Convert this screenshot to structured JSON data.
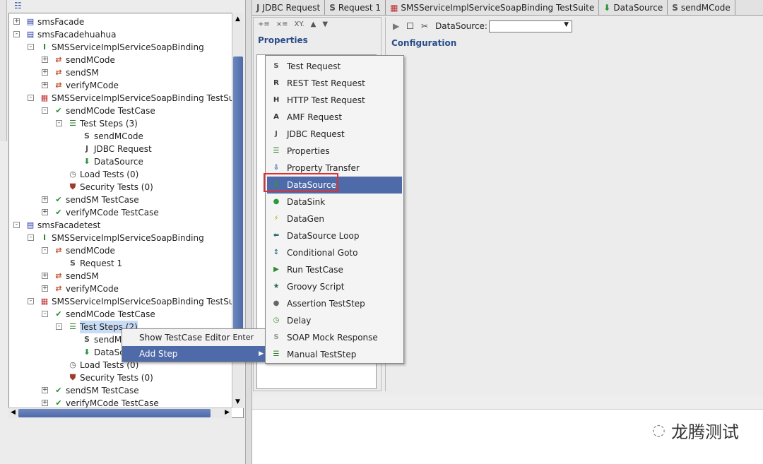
{
  "tree": [
    {
      "label": "smsFacade",
      "level": 0,
      "exp": "+",
      "icon": "project-icon"
    },
    {
      "label": "smsFacadehuahua",
      "level": 0,
      "exp": "-",
      "icon": "project-icon"
    },
    {
      "label": "SMSServiceImplServiceSoapBinding",
      "level": 1,
      "exp": "-",
      "icon": "interface-icon"
    },
    {
      "label": "sendMCode",
      "level": 2,
      "exp": "+",
      "icon": "operation-icon"
    },
    {
      "label": "sendSM",
      "level": 2,
      "exp": "+",
      "icon": "operation-icon"
    },
    {
      "label": "verifyMCode",
      "level": 2,
      "exp": "+",
      "icon": "operation-icon"
    },
    {
      "label": "SMSServiceImplServiceSoapBinding TestSuite",
      "level": 1,
      "exp": "-",
      "icon": "testsuite-icon"
    },
    {
      "label": "sendMCode TestCase",
      "level": 2,
      "exp": "-",
      "icon": "testcase-icon"
    },
    {
      "label": "Test Steps (3)",
      "level": 3,
      "exp": "-",
      "icon": "teststeps-icon"
    },
    {
      "label": "sendMCode",
      "level": 4,
      "exp": "",
      "icon": "soap-icon"
    },
    {
      "label": "JDBC Request",
      "level": 4,
      "exp": "",
      "icon": "jdbc-icon"
    },
    {
      "label": "DataSource",
      "level": 4,
      "exp": "",
      "icon": "datasource-icon"
    },
    {
      "label": "Load Tests (0)",
      "level": 3,
      "exp": "",
      "icon": "loadtest-icon"
    },
    {
      "label": "Security Tests (0)",
      "level": 3,
      "exp": "",
      "icon": "security-icon"
    },
    {
      "label": "sendSM TestCase",
      "level": 2,
      "exp": "+",
      "icon": "testcase-icon"
    },
    {
      "label": "verifyMCode TestCase",
      "level": 2,
      "exp": "+",
      "icon": "testcase-icon"
    },
    {
      "label": "smsFacadetest",
      "level": 0,
      "exp": "-",
      "icon": "project-icon"
    },
    {
      "label": "SMSServiceImplServiceSoapBinding",
      "level": 1,
      "exp": "-",
      "icon": "interface-icon"
    },
    {
      "label": "sendMCode",
      "level": 2,
      "exp": "-",
      "icon": "operation-icon"
    },
    {
      "label": "Request 1",
      "level": 3,
      "exp": "",
      "icon": "soap-icon"
    },
    {
      "label": "sendSM",
      "level": 2,
      "exp": "+",
      "icon": "operation-icon"
    },
    {
      "label": "verifyMCode",
      "level": 2,
      "exp": "+",
      "icon": "operation-icon"
    },
    {
      "label": "SMSServiceImplServiceSoapBinding TestSuite",
      "level": 1,
      "exp": "-",
      "icon": "testsuite-icon"
    },
    {
      "label": "sendMCode TestCase",
      "level": 2,
      "exp": "-",
      "icon": "testcase-icon"
    },
    {
      "label": "Test Steps (2)",
      "level": 3,
      "exp": "-",
      "icon": "teststeps-icon",
      "selected": true
    },
    {
      "label": "sendMCode",
      "level": 4,
      "exp": "",
      "icon": "soap-icon"
    },
    {
      "label": "DataSource",
      "level": 4,
      "exp": "",
      "icon": "datasource-icon"
    },
    {
      "label": "Load Tests (0)",
      "level": 3,
      "exp": "",
      "icon": "loadtest-icon"
    },
    {
      "label": "Security Tests (0)",
      "level": 3,
      "exp": "",
      "icon": "security-icon"
    },
    {
      "label": "sendSM TestCase",
      "level": 2,
      "exp": "+",
      "icon": "testcase-icon"
    },
    {
      "label": "verifyMCode TestCase",
      "level": 2,
      "exp": "+",
      "icon": "testcase-icon"
    }
  ],
  "tabs": [
    {
      "label": "JDBC Request",
      "icon": "jdbc-icon"
    },
    {
      "label": "Request 1",
      "icon": "soap-icon"
    },
    {
      "label": "SMSServiceImplServiceSoapBinding TestSuite",
      "icon": "testsuite-icon"
    },
    {
      "label": "DataSource",
      "icon": "datasource-icon"
    },
    {
      "label": "sendMCode",
      "icon": "soap-icon"
    }
  ],
  "properties": {
    "title": "Properties"
  },
  "config": {
    "title": "Configuration",
    "datasource_label": "DataSource:",
    "datasource_value": ""
  },
  "context_menu": [
    {
      "label": "Show TestCase Editor",
      "shortcut": "Enter"
    },
    {
      "label": "Add Step",
      "submenu": true
    }
  ],
  "add_step_menu": [
    {
      "label": "Test Request",
      "icon": "soap-icon"
    },
    {
      "label": "REST Test Request",
      "icon": "rest-icon"
    },
    {
      "label": "HTTP Test Request",
      "icon": "http-icon"
    },
    {
      "label": "AMF Request",
      "icon": "amf-icon"
    },
    {
      "label": "JDBC Request",
      "icon": "jdbc-icon"
    },
    {
      "label": "Properties",
      "icon": "properties-icon"
    },
    {
      "label": "Property Transfer",
      "icon": "property-transfer-icon"
    },
    {
      "label": "DataSource",
      "icon": "datasource-icon",
      "highlighted": true
    },
    {
      "label": "DataSink",
      "icon": "datasink-icon"
    },
    {
      "label": "DataGen",
      "icon": "datagen-icon"
    },
    {
      "label": "DataSource Loop",
      "icon": "loop-icon"
    },
    {
      "label": "Conditional Goto",
      "icon": "goto-icon"
    },
    {
      "label": "Run TestCase",
      "icon": "run-testcase-icon"
    },
    {
      "label": "Groovy Script",
      "icon": "groovy-star-icon"
    },
    {
      "label": "Assertion TestStep",
      "icon": "assertion-icon"
    },
    {
      "label": "Delay",
      "icon": "delay-clock-icon"
    },
    {
      "label": "SOAP Mock Response",
      "icon": "mock-icon"
    },
    {
      "label": "Manual TestStep",
      "icon": "manual-icon"
    }
  ],
  "watermark": "龙腾测试",
  "colors": {
    "highlight": "#4f6aa8",
    "selection": "#c8dcf5",
    "annotation_box": "#e03030",
    "header": "#2a4d8a"
  }
}
